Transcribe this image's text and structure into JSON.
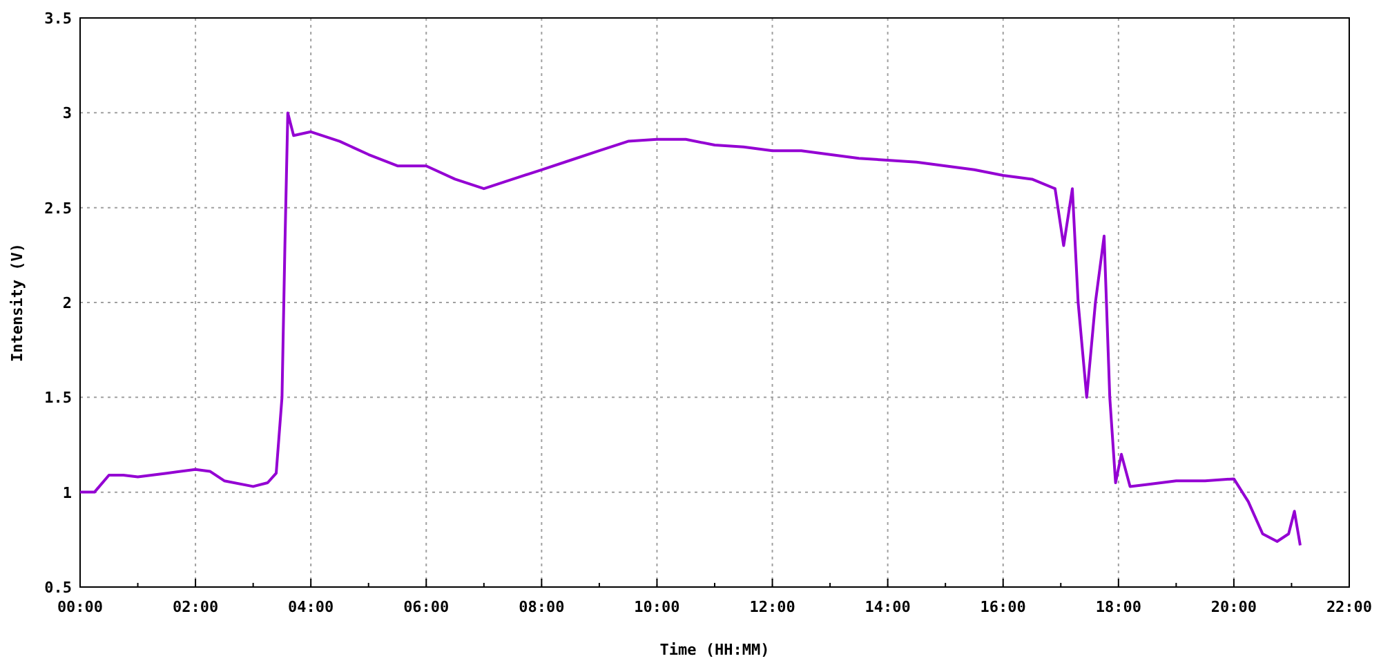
{
  "chart_data": {
    "type": "line",
    "grid": true,
    "xlabel": "Time (HH:MM)",
    "ylabel": "Intensity (V)",
    "xlim": [
      0,
      22
    ],
    "ylim": [
      0.5,
      3.5
    ],
    "xticks": [
      {
        "value": 0,
        "label": "00:00"
      },
      {
        "value": 2,
        "label": "02:00"
      },
      {
        "value": 4,
        "label": "04:00"
      },
      {
        "value": 6,
        "label": "06:00"
      },
      {
        "value": 8,
        "label": "08:00"
      },
      {
        "value": 10,
        "label": "10:00"
      },
      {
        "value": 12,
        "label": "12:00"
      },
      {
        "value": 14,
        "label": "14:00"
      },
      {
        "value": 16,
        "label": "16:00"
      },
      {
        "value": 18,
        "label": "18:00"
      },
      {
        "value": 20,
        "label": "20:00"
      },
      {
        "value": 22,
        "label": "22:00"
      }
    ],
    "yticks": [
      0.5,
      1,
      1.5,
      2,
      2.5,
      3,
      3.5
    ],
    "x": [
      0,
      0.25,
      0.5,
      0.75,
      1,
      1.5,
      2,
      2.25,
      2.5,
      3,
      3.25,
      3.4,
      3.5,
      3.55,
      3.6,
      3.7,
      4,
      4.5,
      5,
      5.5,
      6,
      6.5,
      7,
      7.5,
      8,
      8.5,
      9,
      9.5,
      10,
      10.5,
      11,
      11.5,
      12,
      12.5,
      13,
      13.5,
      14,
      14.5,
      15,
      15.5,
      16,
      16.5,
      16.9,
      17.05,
      17.2,
      17.3,
      17.45,
      17.6,
      17.75,
      17.85,
      17.95,
      18.05,
      18.2,
      18.5,
      19,
      19.5,
      20,
      20.25,
      20.5,
      20.75,
      20.95,
      21.05,
      21.15
    ],
    "series": [
      {
        "color": "#9400d3",
        "values": [
          1.0,
          1.0,
          1.09,
          1.09,
          1.08,
          1.1,
          1.12,
          1.11,
          1.06,
          1.03,
          1.05,
          1.1,
          1.5,
          2.3,
          3.0,
          2.88,
          2.9,
          2.85,
          2.78,
          2.72,
          2.72,
          2.65,
          2.6,
          2.65,
          2.7,
          2.75,
          2.8,
          2.85,
          2.86,
          2.86,
          2.83,
          2.82,
          2.8,
          2.8,
          2.78,
          2.76,
          2.75,
          2.74,
          2.72,
          2.7,
          2.67,
          2.65,
          2.6,
          2.3,
          2.6,
          2.0,
          1.5,
          2.0,
          2.35,
          1.5,
          1.05,
          1.2,
          1.03,
          1.04,
          1.06,
          1.06,
          1.07,
          0.95,
          0.78,
          0.74,
          0.78,
          0.9,
          0.72
        ]
      }
    ]
  }
}
